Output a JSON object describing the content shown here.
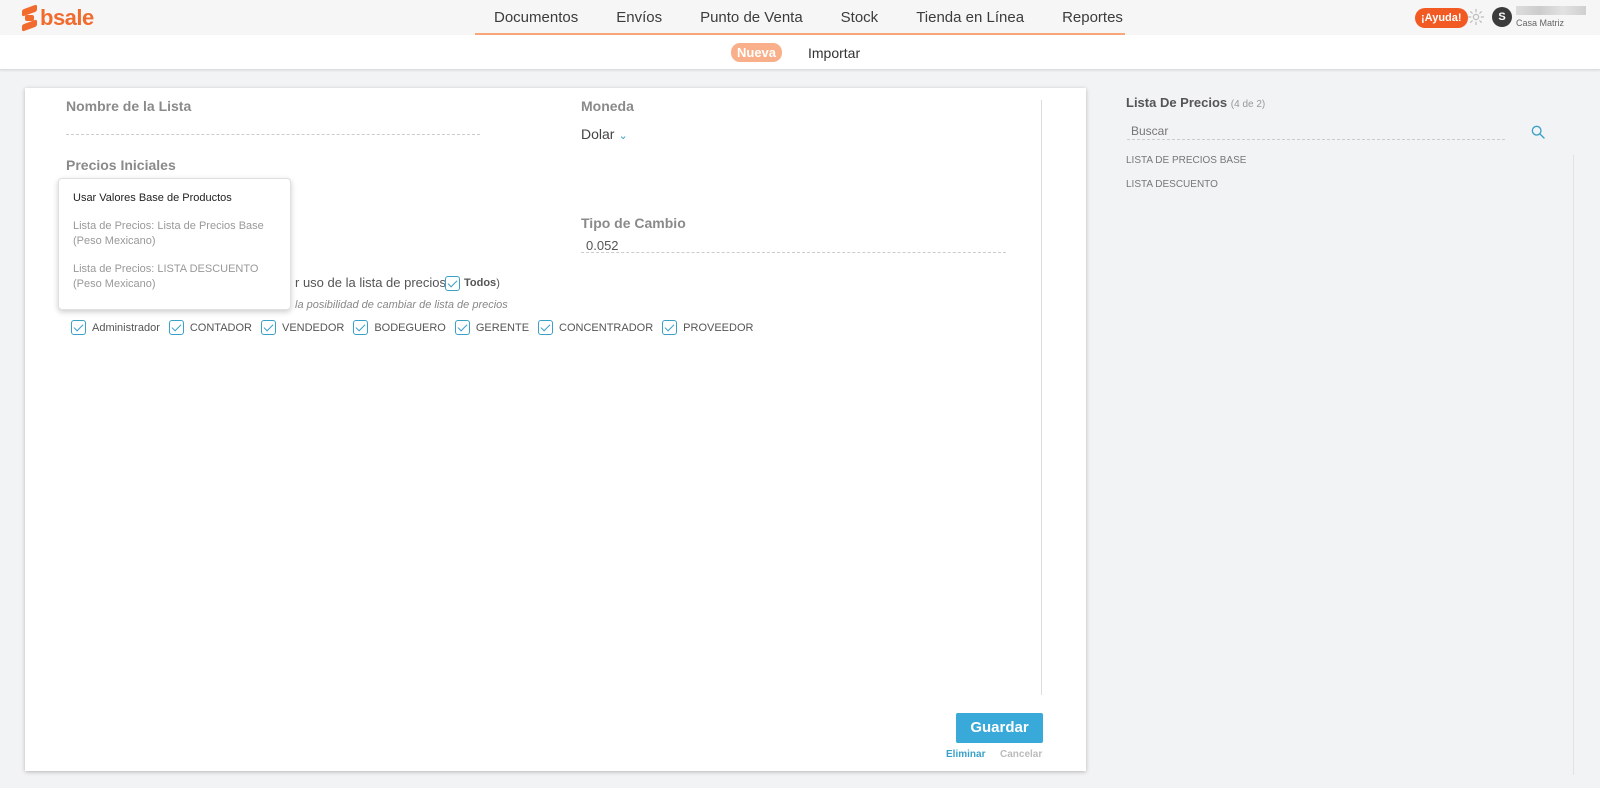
{
  "brand": {
    "name": "bsale",
    "color": "#f26b2e"
  },
  "nav": {
    "items": [
      "Documentos",
      "Envíos",
      "Punto de Venta",
      "Stock",
      "Tienda en Línea",
      "Reportes"
    ],
    "help_label": "¡Ayuda!",
    "gear_icon": "gear-icon",
    "avatar_initial": "S",
    "branch": "Casa Matriz"
  },
  "subnav": {
    "new_label": "Nueva",
    "import_label": "Importar"
  },
  "form": {
    "list_name_label": "Nombre de la Lista",
    "list_name_value": "",
    "currency_label": "Moneda",
    "currency_value": "Dolar",
    "initial_prices_label": "Precios Iniciales",
    "exchange_label": "Tipo de Cambio",
    "exchange_value": "0.052",
    "permission_text": "r uso de la lista de precios (",
    "todos_label": "Todos",
    "permission_note": "la posibilidad de cambiar de lista de precios",
    "roles": [
      "Administrador",
      "CONTADOR",
      "VENDEDOR",
      "BODEGUERO",
      "GERENTE",
      "CONCENTRADOR",
      "PROVEEDOR"
    ]
  },
  "dropdown": {
    "options": [
      {
        "label": "Usar Valores Base de Productos",
        "selected": true
      },
      {
        "label": "Lista de Precios: Lista de Precios Base (Peso Mexicano)",
        "selected": false
      },
      {
        "label": "Lista de Precios: LISTA DESCUENTO (Peso Mexicano)",
        "selected": false
      }
    ]
  },
  "actions": {
    "save_label": "Guardar",
    "delete_label": "Eliminar",
    "cancel_label": "Cancelar"
  },
  "right_panel": {
    "title": "Lista De Precios",
    "count": "(4 de 2)",
    "search_placeholder": "Buscar",
    "search_icon": "search-icon",
    "items": [
      "LISTA DE PRECIOS BASE",
      "LISTA DESCUENTO"
    ]
  },
  "colors": {
    "accent": "#38a9d8",
    "brand": "#f26b2e",
    "help": "#f15a22"
  }
}
